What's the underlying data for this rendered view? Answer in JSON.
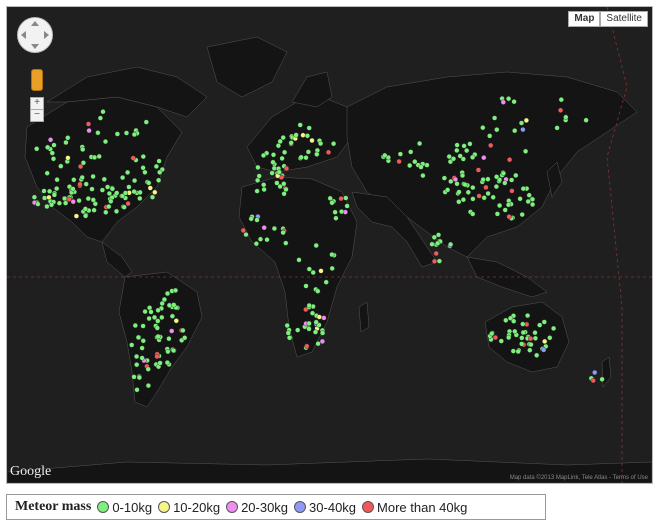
{
  "map_controls": {
    "map_label": "Map",
    "satellite_label": "Satellite",
    "zoom_in": "+",
    "zoom_out": "−"
  },
  "branding": {
    "google": "Google",
    "attribution": "Map data ©2013 MapLink, Tele Atlas - Terms of Use"
  },
  "legend": {
    "title": "Meteor mass",
    "items": [
      {
        "label": "0-10kg",
        "color": "#7ef07e"
      },
      {
        "label": "10-20kg",
        "color": "#f5f58a"
      },
      {
        "label": "20-30kg",
        "color": "#f08ef0"
      },
      {
        "label": "30-40kg",
        "color": "#8f9af5"
      },
      {
        "label": "More than 40kg",
        "color": "#f05a5a"
      }
    ]
  },
  "colors": {
    "ocean": "#1f1f1f",
    "land": "#141414",
    "border": "#555555",
    "tropic_line": "#8a3030"
  }
}
